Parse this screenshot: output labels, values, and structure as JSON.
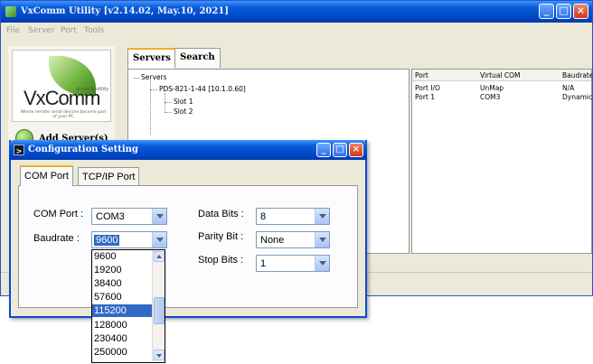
{
  "main_window": {
    "title": "VxComm Utility [v2.14.02, May.10, 2021]",
    "menu": [
      "File",
      "Server",
      "Port",
      "Tools"
    ],
    "logo": {
      "wordmark": "VxComm",
      "subtitle": "driver & utility",
      "tagline": "Where remote serial devices become part of your PC"
    },
    "add_server_label": "Add Server(s)",
    "tabs": [
      "Servers",
      "Search"
    ],
    "tree": {
      "root": "Servers",
      "device": "PDS-821-1-44 [10.1.0.60]",
      "slots": [
        "Slot 1",
        "Slot 2"
      ]
    },
    "port_table": {
      "columns": [
        "Port",
        "Virtual COM",
        "Baudrate"
      ],
      "rows": [
        [
          "Port I/O",
          "UnMap",
          "N/A"
        ],
        [
          "Port 1",
          "COM3",
          "Dynamic"
        ]
      ]
    }
  },
  "dialog": {
    "title": "Configuration Setting",
    "tabs": [
      "COM Port",
      "TCP/IP Port"
    ],
    "fields": {
      "com_port": {
        "label": "COM Port :",
        "value": "COM3"
      },
      "baudrate": {
        "label": "Baudrate :",
        "value": "9600"
      },
      "data_bits": {
        "label": "Data Bits :",
        "value": "8"
      },
      "parity_bit": {
        "label": "Parity Bit :",
        "value": "None"
      },
      "stop_bits": {
        "label": "Stop Bits :",
        "value": "1"
      }
    },
    "baudrate_options": [
      "9600",
      "19200",
      "38400",
      "57600",
      "115200",
      "128000",
      "230400",
      "250000"
    ],
    "highlighted_option": "115200"
  },
  "colors": {
    "titlebar": "#0a5bd8",
    "selection": "#316ac5",
    "window_bg": "#ece9d8",
    "close_button": "#d03a16"
  }
}
